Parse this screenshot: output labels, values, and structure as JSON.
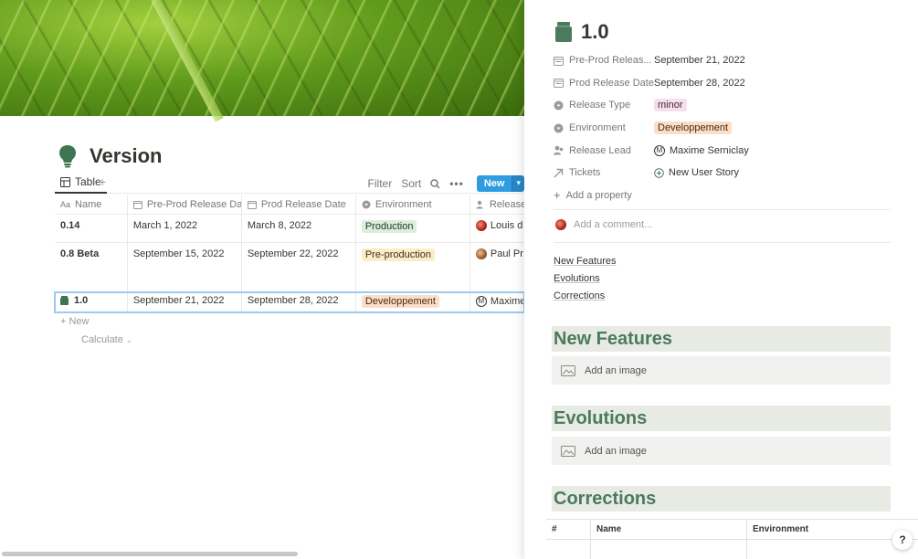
{
  "database": {
    "title": "Version",
    "view_tab": "Table",
    "toolbar": {
      "filter": "Filter",
      "sort": "Sort",
      "new": "New"
    },
    "columns": [
      "Name",
      "Pre-Prod Release Date",
      "Prod Release Date",
      "Environment",
      "Release"
    ],
    "rows": [
      {
        "name": "0.14",
        "preprod": "March 1, 2022",
        "prod": "March 8, 2022",
        "environment": "Production",
        "lead": "Louis d"
      },
      {
        "name": "0.8 Beta",
        "preprod": "September 15, 2022",
        "prod": "September 22, 2022",
        "environment": "Pre-production",
        "lead": "Paul Pr"
      },
      {
        "name": "1.0",
        "preprod": "September 21, 2022",
        "prod": "September 28, 2022",
        "environment": "Developpement",
        "lead": "Maxime"
      }
    ],
    "new_row": "New",
    "calculate": "Calculate"
  },
  "peek": {
    "title": "1.0",
    "properties": [
      {
        "name": "Pre-Prod Releas...",
        "value": "September 21, 2022",
        "icon": "calendar-icon"
      },
      {
        "name": "Prod Release Date",
        "value": "September 28, 2022",
        "icon": "calendar-icon"
      },
      {
        "name": "Release Type",
        "value": "minor",
        "icon": "select-icon"
      },
      {
        "name": "Environment",
        "value": "Developpement",
        "icon": "select-icon"
      },
      {
        "name": "Release Lead",
        "value": "Maxime Serniclay",
        "icon": "person-icon"
      },
      {
        "name": "Tickets",
        "value": "New User Story",
        "icon": "relation-arrow-icon"
      }
    ],
    "add_property": "Add a property",
    "comment_placeholder": "Add a comment...",
    "toc": [
      "New Features",
      "Evolutions",
      "Corrections"
    ],
    "sections": [
      "New Features",
      "Evolutions",
      "Corrections"
    ],
    "add_image": "Add an image",
    "corrections_table_headers": [
      "#",
      "Name",
      "Environment"
    ]
  },
  "help": "?",
  "colors": {
    "accent": "#2f9be0",
    "section_bg": "#e7ebe3",
    "section_text": "#4b7a5d"
  }
}
